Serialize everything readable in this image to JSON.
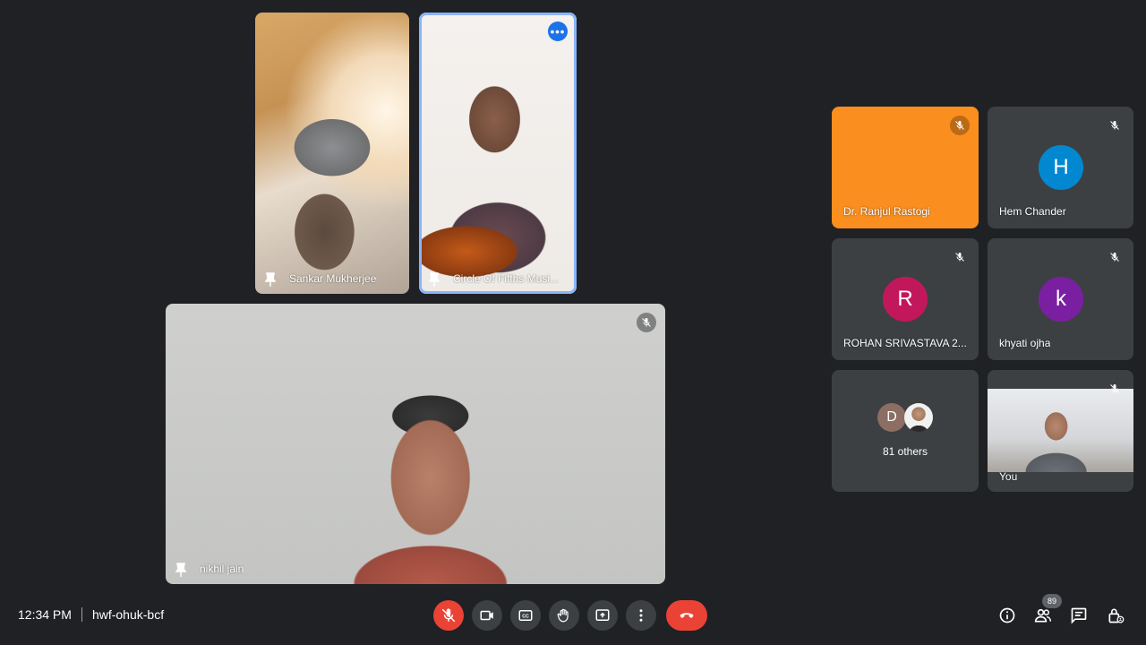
{
  "participants": {
    "sankar": {
      "name": "Sankar Mukherjee"
    },
    "circle": {
      "name": "Circle Of Fifths Musi..."
    },
    "nikhil": {
      "name": "nikhil jain"
    },
    "ranjul": {
      "name": "Dr. Ranjul Rastogi",
      "tile_color": "#fa8e1e"
    },
    "hem": {
      "name": "Hem Chander",
      "initial": "H",
      "avatar_color": "#0288d1"
    },
    "rohan": {
      "name": "ROHAN SRIVASTAVA 2...",
      "initial": "R",
      "avatar_color": "#c2185b"
    },
    "khyati": {
      "name": "khyati ojha",
      "initial": "k",
      "avatar_color": "#7b1fa2"
    },
    "others": {
      "label": "81 others",
      "initial": "D",
      "avatar_color": "#8d6e63"
    },
    "you": {
      "name": "You"
    }
  },
  "meeting": {
    "time": "12:34 PM",
    "code": "hwf-ohuk-bcf"
  },
  "participants_count": "89",
  "controls": [
    "mic-off",
    "camera",
    "captions",
    "raise-hand",
    "present",
    "more",
    "end-call"
  ],
  "right_controls": [
    "info",
    "people",
    "chat",
    "activities"
  ]
}
